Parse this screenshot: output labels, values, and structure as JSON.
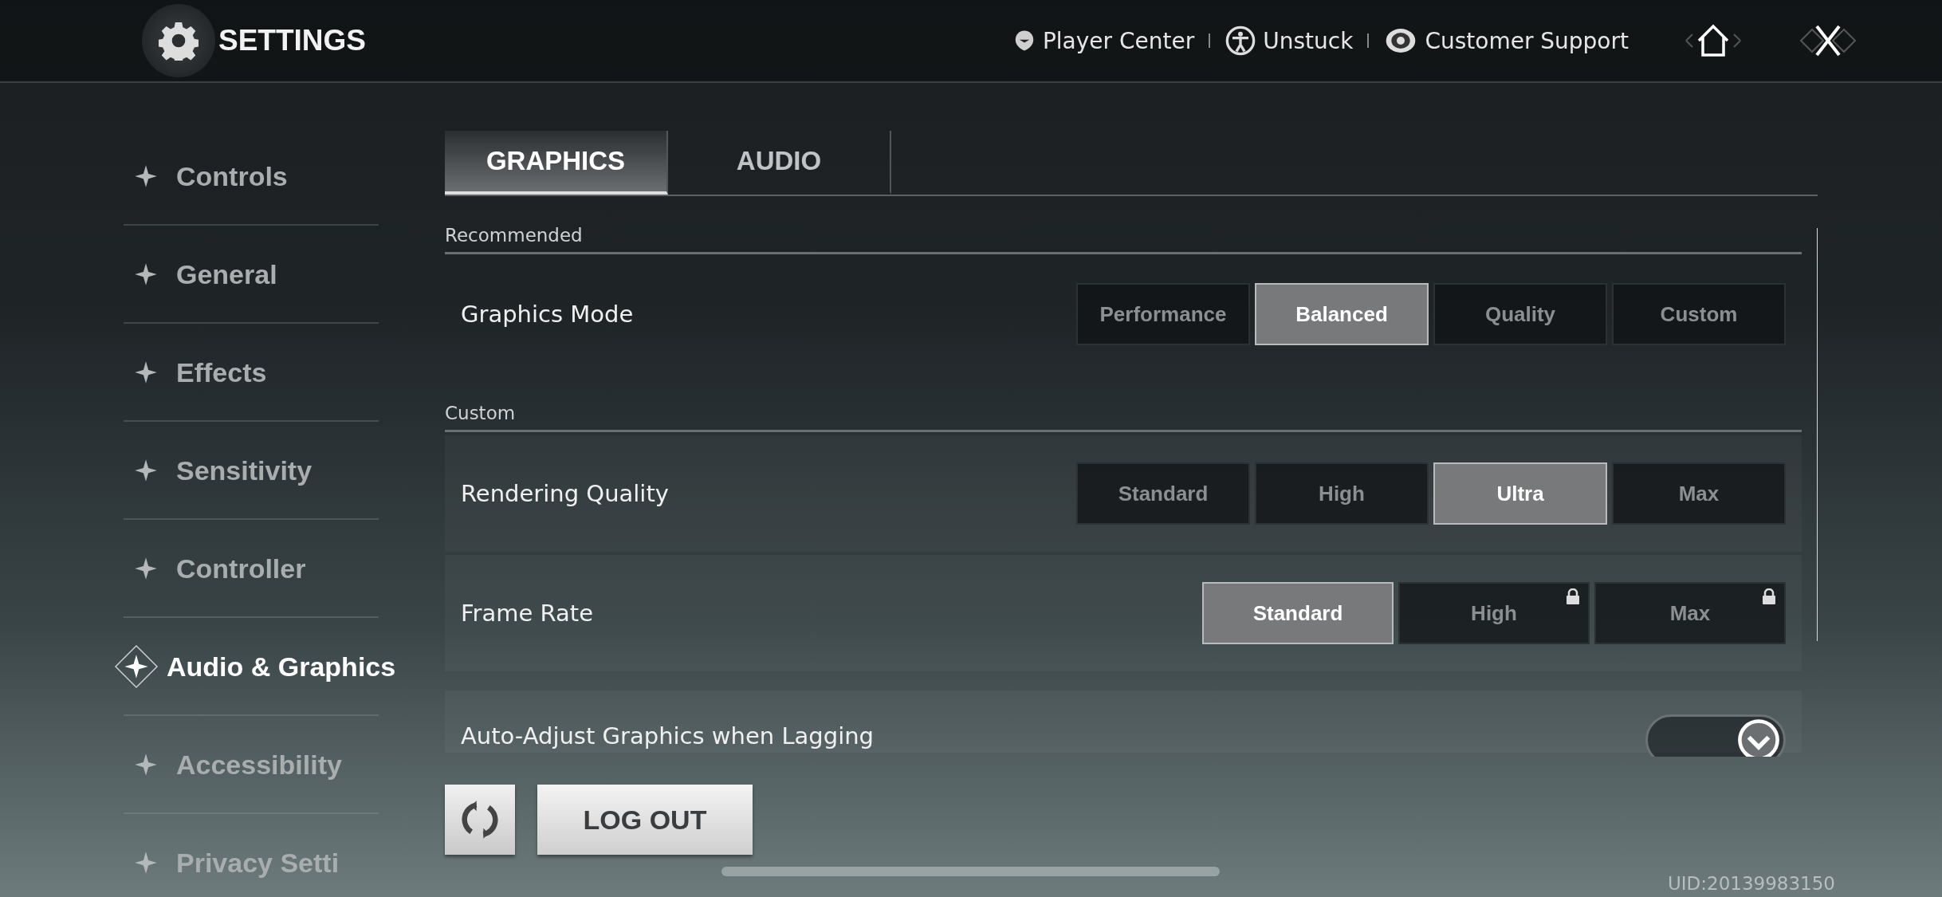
{
  "header": {
    "title": "SETTINGS",
    "links": [
      {
        "kind": "player",
        "label": "Player Center"
      },
      {
        "kind": "unstuck",
        "label": "Unstuck"
      },
      {
        "kind": "support",
        "label": "Customer Support"
      }
    ]
  },
  "sidebar": {
    "items": [
      {
        "label": "Controls",
        "selected": false
      },
      {
        "label": "General",
        "selected": false
      },
      {
        "label": "Effects",
        "selected": false
      },
      {
        "label": "Sensitivity",
        "selected": false
      },
      {
        "label": "Controller",
        "selected": false
      },
      {
        "label": "Audio & Graphics",
        "selected": true
      },
      {
        "label": "Accessibility",
        "selected": false
      },
      {
        "label": "Privacy Setti",
        "selected": false
      }
    ]
  },
  "tabs": [
    {
      "label": "GRAPHICS",
      "selected": true
    },
    {
      "label": "AUDIO",
      "selected": false
    }
  ],
  "sections": [
    {
      "title": "Recommended",
      "rows": [
        {
          "kind": "options",
          "label": "Graphics Mode",
          "options": [
            {
              "label": "Performance",
              "selected": false,
              "locked": false
            },
            {
              "label": "Balanced",
              "selected": true,
              "locked": false
            },
            {
              "label": "Quality",
              "selected": false,
              "locked": false
            },
            {
              "label": "Custom",
              "selected": false,
              "locked": false
            }
          ]
        }
      ]
    },
    {
      "title": "Custom",
      "rows": [
        {
          "kind": "options",
          "label": "Rendering Quality",
          "options": [
            {
              "label": "Standard",
              "selected": false,
              "locked": false
            },
            {
              "label": "High",
              "selected": false,
              "locked": false
            },
            {
              "label": "Ultra",
              "selected": true,
              "locked": false
            },
            {
              "label": "Max",
              "selected": false,
              "locked": false
            }
          ]
        },
        {
          "kind": "options",
          "label": "Frame Rate",
          "options": [
            {
              "label": "Standard",
              "selected": true,
              "locked": false
            },
            {
              "label": "High",
              "selected": false,
              "locked": true
            },
            {
              "label": "Max",
              "selected": false,
              "locked": true
            }
          ]
        },
        {
          "kind": "toggle",
          "label": "Auto-Adjust Graphics when Lagging",
          "on": true
        }
      ]
    }
  ],
  "footer": {
    "logout": "LOG OUT",
    "uid": "UID:20139983150"
  }
}
